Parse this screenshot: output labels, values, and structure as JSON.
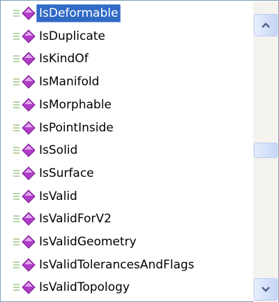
{
  "list": {
    "selected_index": 0,
    "items": [
      {
        "label": "IsDeformable"
      },
      {
        "label": "IsDuplicate"
      },
      {
        "label": "IsKindOf"
      },
      {
        "label": "IsManifold"
      },
      {
        "label": "IsMorphable"
      },
      {
        "label": "IsPointInside"
      },
      {
        "label": "IsSolid"
      },
      {
        "label": "IsSurface"
      },
      {
        "label": "IsValid"
      },
      {
        "label": "IsValidForV2"
      },
      {
        "label": "IsValidGeometry"
      },
      {
        "label": "IsValidTolerancesAndFlags"
      },
      {
        "label": "IsValidTopology"
      }
    ]
  },
  "icons": {
    "member_icon": "method-icon",
    "scroll_up": "chevron-up-icon",
    "scroll_down": "chevron-down-icon"
  },
  "colors": {
    "selection": "#316ac5",
    "method_icon": "#b03cc8",
    "border": "#7f9db9"
  },
  "scrollbar": {
    "position_fraction": 0.47
  }
}
